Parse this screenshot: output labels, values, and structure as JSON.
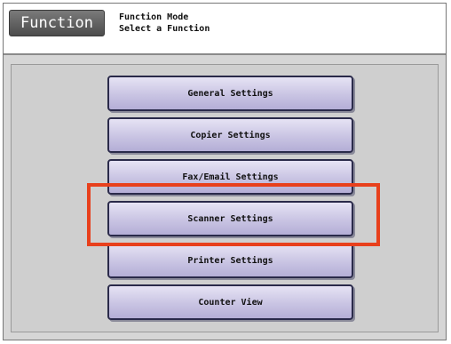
{
  "header": {
    "title": "Function",
    "line1": "Function Mode",
    "line2": "Select a Function"
  },
  "menu": {
    "items": [
      {
        "label": "General Settings"
      },
      {
        "label": "Copier Settings"
      },
      {
        "label": "Fax/Email Settings"
      },
      {
        "label": "Scanner Settings"
      },
      {
        "label": "Printer Settings"
      },
      {
        "label": "Counter View"
      }
    ],
    "highlighted_item": "Scanner Settings"
  },
  "colors": {
    "highlight": "#e8401c",
    "button_face": "#c9c4e3"
  }
}
